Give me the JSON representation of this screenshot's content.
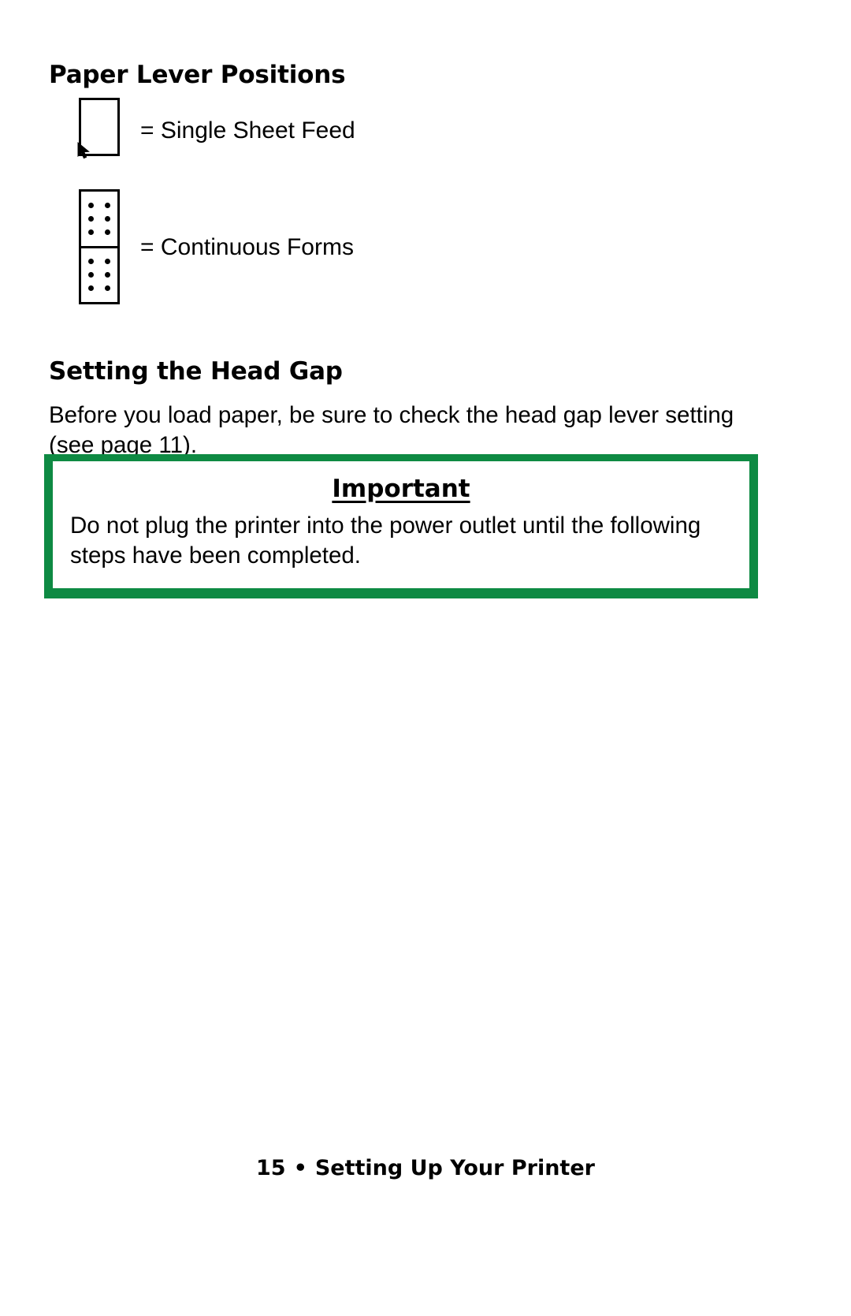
{
  "page": {
    "background": "#ffffff",
    "accent_green": "#0E8A43"
  },
  "sections": {
    "paper_lever": {
      "heading": "Paper Lever Positions",
      "legend": [
        {
          "icon": "single-sheet-icon",
          "label": "= Single Sheet Feed"
        },
        {
          "icon": "continuous-forms-icon",
          "label": "= Continuous Forms"
        }
      ]
    },
    "head_gap": {
      "heading": "Setting the Head Gap",
      "paragraph": "Before you load paper, be sure to check the head gap lever setting (see page 11)."
    }
  },
  "important_box": {
    "title": "Important",
    "body": "Do not plug the printer into the power outlet until the following steps have been completed."
  },
  "footer": {
    "page_number": "15",
    "separator": "•",
    "section_title": "Setting Up Your Printer"
  }
}
